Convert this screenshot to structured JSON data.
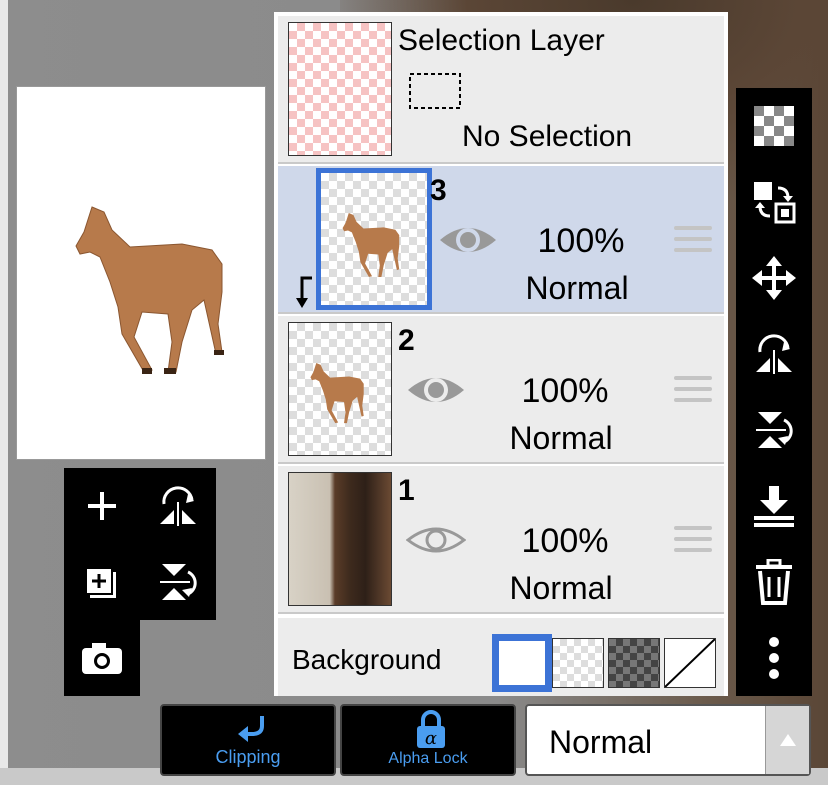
{
  "selection_layer": {
    "title": "Selection Layer",
    "status": "No Selection"
  },
  "layers": [
    {
      "number": "3",
      "opacity": "100%",
      "mode": "Normal"
    },
    {
      "number": "2",
      "opacity": "100%",
      "mode": "Normal"
    },
    {
      "number": "1",
      "opacity": "100%",
      "mode": "Normal"
    }
  ],
  "background": {
    "label": "Background"
  },
  "bottom": {
    "clipping_label": "Clipping",
    "alpha_lock_label": "Alpha Lock",
    "blend_mode": "Normal"
  },
  "icons": {
    "left_tools": [
      "add-layer-icon",
      "flip-horizontal-icon",
      "add-layer-copy-icon",
      "flip-vertical-icon",
      "camera-icon"
    ],
    "right_tools": [
      "transparency-icon",
      "swap-layers-icon",
      "move-icon",
      "flip-horizontal-icon",
      "flip-vertical-icon",
      "merge-down-icon",
      "trash-icon",
      "more-icon"
    ]
  },
  "colors": {
    "accent": "#3c73d6",
    "selected_row": "#cfd8ea",
    "toolbar": "#000000",
    "label_blue": "#4a9df0"
  }
}
